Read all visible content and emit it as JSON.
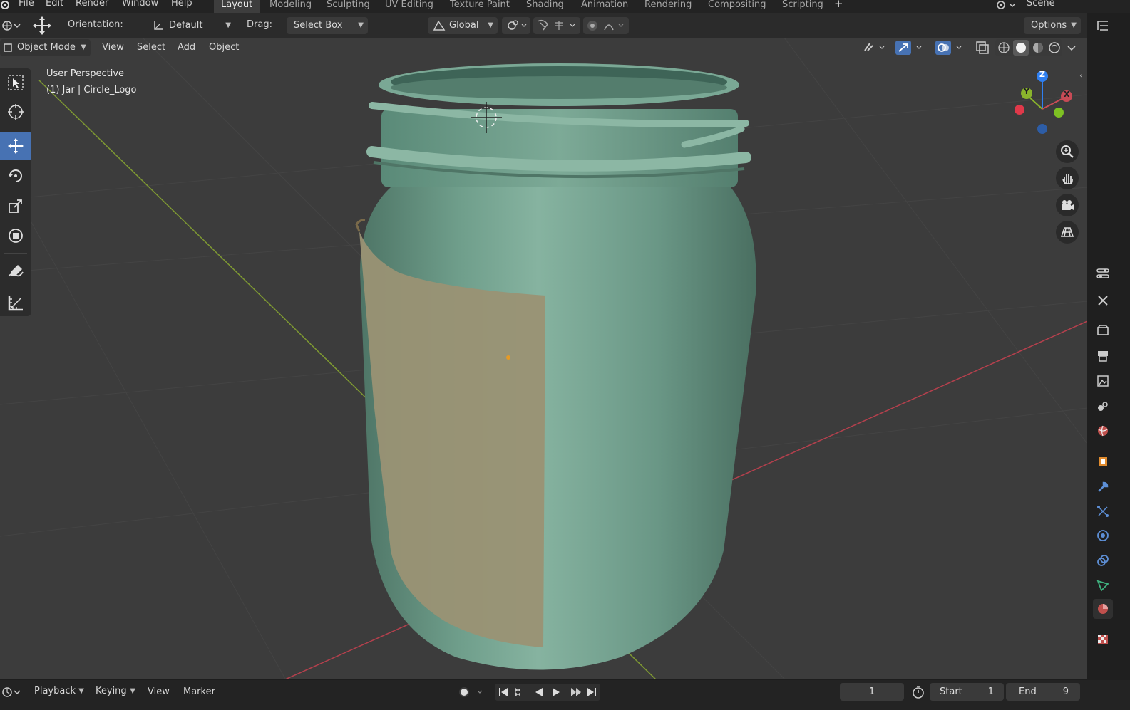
{
  "top_menu": [
    "File",
    "Edit",
    "Render",
    "Window",
    "Help"
  ],
  "workspace_tabs": [
    "Layout",
    "Modeling",
    "Sculpting",
    "UV Editing",
    "Texture Paint",
    "Shading",
    "Animation",
    "Rendering",
    "Compositing",
    "Scripting"
  ],
  "active_tab": "Layout",
  "add_workspace": "+",
  "scene_name": "Scene",
  "tool_header": {
    "orientation_label": "Orientation:",
    "orientation_value": "Default",
    "drag_label": "Drag:",
    "drag_value": "Select Box",
    "transform_orientation": "Global",
    "options_label": "Options"
  },
  "viewport_header": {
    "mode": "Object Mode",
    "menus": [
      "View",
      "Select",
      "Add",
      "Object"
    ]
  },
  "viewport_overlay": {
    "perspective": "User Perspective",
    "selection": "(1) Jar | Circle_Logo"
  },
  "gizmo_axes": [
    "X",
    "Y",
    "Z"
  ],
  "colors": {
    "jar": "#6f9e8b",
    "label": "#9a9274",
    "x_axis": "#c84b56",
    "y_axis": "#8ab42c",
    "z_axis": "#2f7ff0",
    "active_tool": "#4772b3"
  },
  "timeline": {
    "menus": [
      "Playback",
      "Keying",
      "View",
      "Marker"
    ],
    "current_frame": "1",
    "start_label": "Start",
    "start_value": "1",
    "end_label": "End",
    "end_value": "9"
  }
}
